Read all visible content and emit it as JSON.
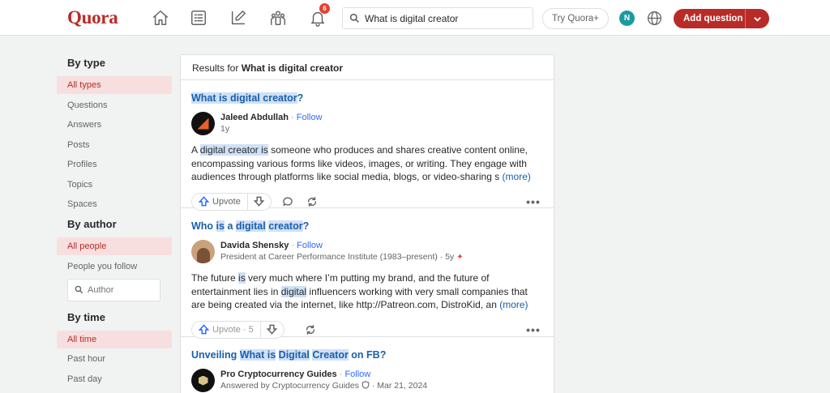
{
  "header": {
    "logo": "Quora",
    "notification_count": "6",
    "search_value": "What is digital creator",
    "try_label": "Try Quora+",
    "user_initial": "N",
    "add_question_label": "Add question"
  },
  "sidebar": {
    "by_type_title": "By type",
    "types": [
      "All types",
      "Questions",
      "Answers",
      "Posts",
      "Profiles",
      "Topics",
      "Spaces"
    ],
    "by_author_title": "By author",
    "authors": [
      "All people",
      "People you follow"
    ],
    "author_placeholder": "Author",
    "by_time_title": "By time",
    "times": [
      "All time",
      "Past hour",
      "Past day"
    ]
  },
  "results": {
    "header_prefix": "Results for",
    "query": "What is digital creator",
    "items": [
      {
        "title_parts": [
          "What",
          " ",
          "is",
          " ",
          "digital",
          " ",
          "creator",
          "?"
        ],
        "author": "Jaleed Abdullah",
        "follow": "Follow",
        "meta": "1y",
        "body_parts": [
          "A ",
          "digital",
          " ",
          "creator",
          " ",
          "is",
          " someone who produces and shares creative content online, encompassing various forms like videos, images, or writing. They engage with audiences through platforms like social media, blogs, or video-sharing s"
        ],
        "more": "(more)",
        "upvote": "Upvote"
      },
      {
        "title_parts": [
          "Who ",
          "is",
          " a ",
          "digital",
          " ",
          "creator",
          "?"
        ],
        "author": "Davida Shensky",
        "follow": "Follow",
        "meta": "President at Career Performance Institute (1983–present) · 5y",
        "body_parts": [
          "The future ",
          "is",
          " very much where I’m putting my brand, and the future of entertainment lies in ",
          "digital",
          " influencers working with very small companies that are being created via the internet, like http://Patreon.com, DistroKid, an"
        ],
        "more": "(more)",
        "upvote": "Upvote · 5"
      },
      {
        "title_parts": [
          "Unveiling ",
          "What is",
          " ",
          "Digital",
          " ",
          "Creator",
          " on FB?"
        ],
        "author": "Pro Cryptocurrency Guides",
        "follow": "Follow",
        "meta_a": "Answered by Cryptocurrency Guides",
        "meta_b": "· Mar 21, 2024"
      }
    ]
  },
  "colors": {
    "brand": "#b92b27",
    "link": "#195faa",
    "highlight": "#cfe0f7"
  }
}
